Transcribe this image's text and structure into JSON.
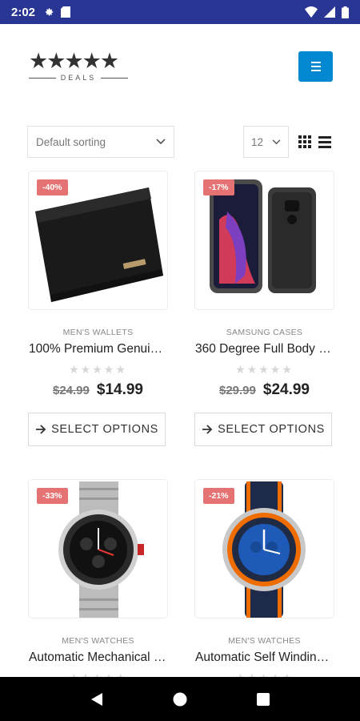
{
  "status_bar": {
    "time": "2:02",
    "left_icons": [
      "settings-icon",
      "sd-card-icon"
    ],
    "right_icons": [
      "wifi-icon",
      "signal-icon",
      "battery-icon"
    ],
    "background": "#283593"
  },
  "header": {
    "logo_stars": "★★★★★",
    "logo_text": "DEALS",
    "menu_button_color": "#0288d1"
  },
  "toolbar": {
    "sort_value": "Default sorting",
    "per_page_value": "12"
  },
  "products": [
    {
      "badge": "-40%",
      "category": "MEN'S WALLETS",
      "title": "100% Premium Genuine Leather Wallet",
      "rating_stars": "★★★★★",
      "old_price": "$24.99",
      "new_price": "$14.99",
      "button": "SELECT OPTIONS"
    },
    {
      "badge": "-17%",
      "category": "SAMSUNG CASES",
      "title": "360 Degree Full Body Case",
      "rating_stars": "★★★★★",
      "old_price": "$29.99",
      "new_price": "$24.99",
      "button": "SELECT OPTIONS"
    },
    {
      "badge": "-33%",
      "category": "MEN'S WATCHES",
      "title": "Automatic Mechanical Watch",
      "rating_stars": "★★★★★"
    },
    {
      "badge": "-21%",
      "category": "MEN'S WATCHES",
      "title": "Automatic Self Winding Watch",
      "rating_stars": "★★★★★"
    }
  ],
  "colors": {
    "badge": "#e57373",
    "accent": "#0288d1"
  }
}
